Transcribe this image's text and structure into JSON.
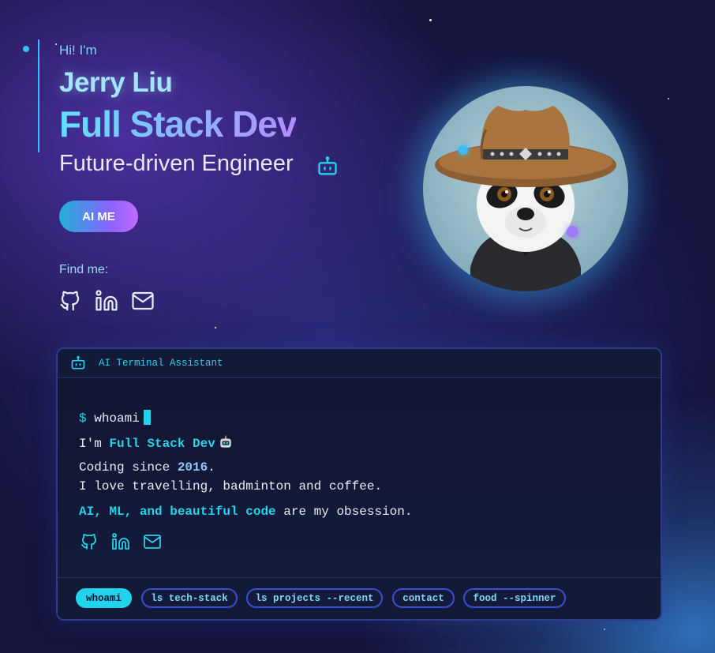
{
  "hero": {
    "greeting": "Hi! I'm",
    "name": "Jerry Liu",
    "role": "Full Stack Dev",
    "subtitle": "Future-driven Engineer",
    "cta_label": "AI ME",
    "find_me": "Find me:",
    "social_icons": [
      "github-icon",
      "linkedin-icon",
      "mail-icon"
    ]
  },
  "avatar": {
    "alt": "panda-with-cowboy-hat"
  },
  "terminal": {
    "title": "AI Terminal Assistant",
    "prompt_symbol": "$",
    "command": "whoami",
    "line1_prefix": "I'm ",
    "line1_highlight": "Full Stack Dev",
    "line2_prefix": "Coding since ",
    "line2_year": "2016",
    "line2_suffix": ".",
    "line3": "I love travelling, badminton and coffee.",
    "line4_highlight": "AI, ML, and beautiful code",
    "line4_suffix": " are my obsession.",
    "chips": [
      "whoami",
      "ls tech-stack",
      "ls projects --recent",
      "contact",
      "food --spinner"
    ],
    "active_chip": "whoami"
  },
  "colors": {
    "accent_cyan": "#22d3ee",
    "accent_purple": "#a78bfa",
    "background": "#15143d"
  }
}
